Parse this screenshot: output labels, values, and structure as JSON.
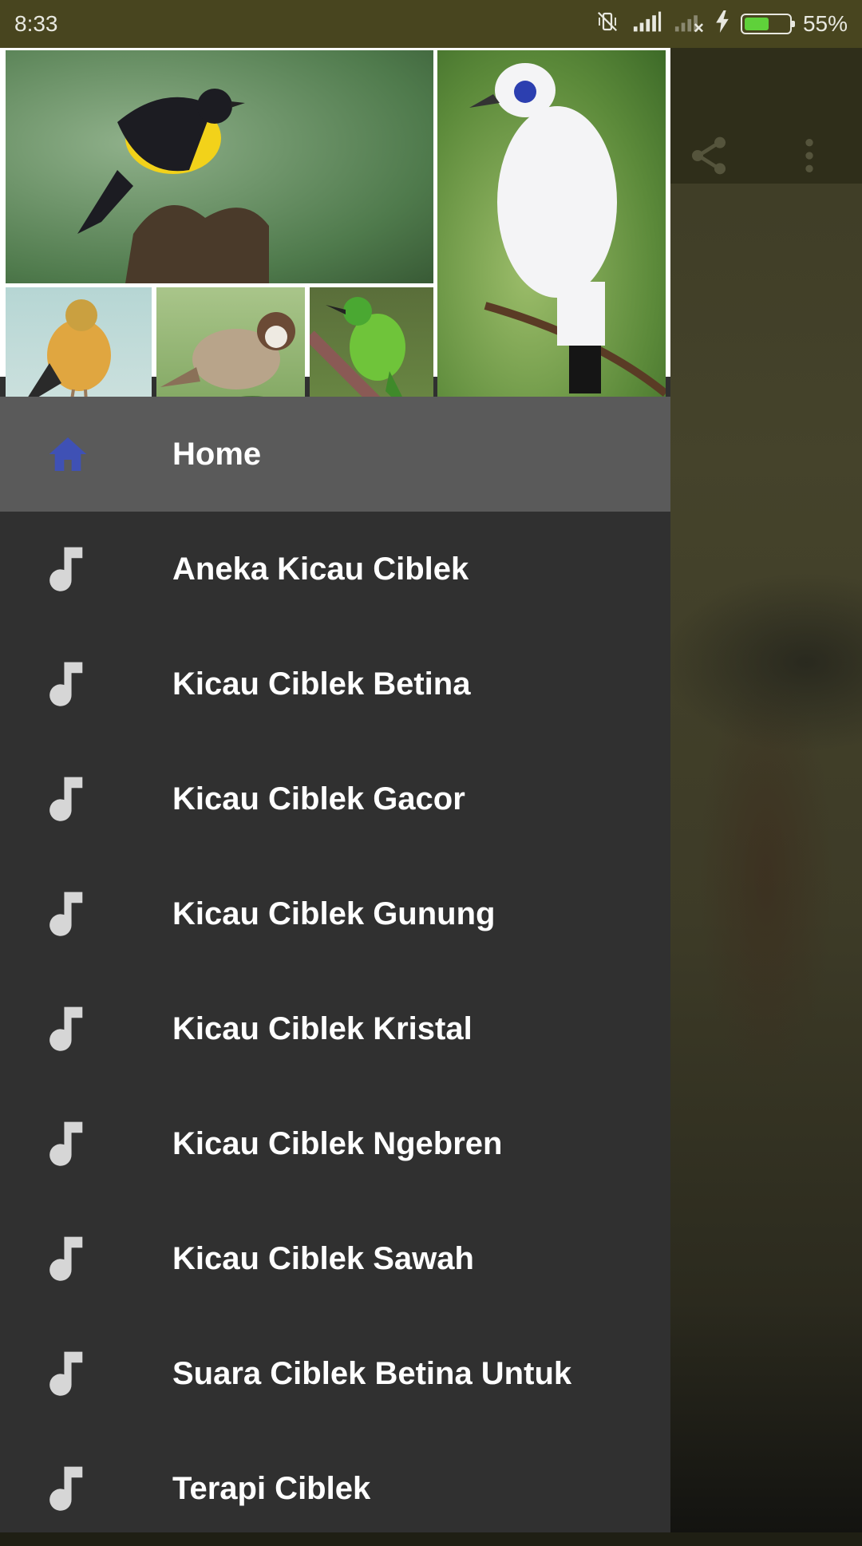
{
  "status_bar": {
    "time": "8:33",
    "battery_percent_text": "55%",
    "battery_level": 0.55,
    "icons": [
      "vibrate-off-icon",
      "signal-icon",
      "signal-no-service-icon",
      "charging-icon",
      "battery-icon"
    ]
  },
  "toolbar": {
    "icons": [
      "share-icon",
      "overflow-menu-icon"
    ]
  },
  "drawer": {
    "header_image": "bird-collage",
    "items": [
      {
        "label": "Home",
        "icon": "home-icon",
        "active": true
      },
      {
        "label": "Aneka Kicau Ciblek",
        "icon": "music-note-icon"
      },
      {
        "label": "Kicau Ciblek Betina",
        "icon": "music-note-icon"
      },
      {
        "label": "Kicau Ciblek Gacor",
        "icon": "music-note-icon"
      },
      {
        "label": "Kicau Ciblek Gunung",
        "icon": "music-note-icon"
      },
      {
        "label": "Kicau Ciblek Kristal",
        "icon": "music-note-icon"
      },
      {
        "label": "Kicau Ciblek Ngebren",
        "icon": "music-note-icon"
      },
      {
        "label": "Kicau Ciblek Sawah",
        "icon": "music-note-icon"
      },
      {
        "label": "Suara Ciblek Betina Untuk",
        "icon": "music-note-icon"
      },
      {
        "label": "Terapi Ciblek",
        "icon": "music-note-icon"
      }
    ]
  },
  "colors": {
    "drawer_bg": "#303030",
    "active_item_bg": "#5a5a5a",
    "home_icon": "#3f51b5",
    "note_icon": "#d6d6d6",
    "status_bar_bg": "#48451f"
  }
}
